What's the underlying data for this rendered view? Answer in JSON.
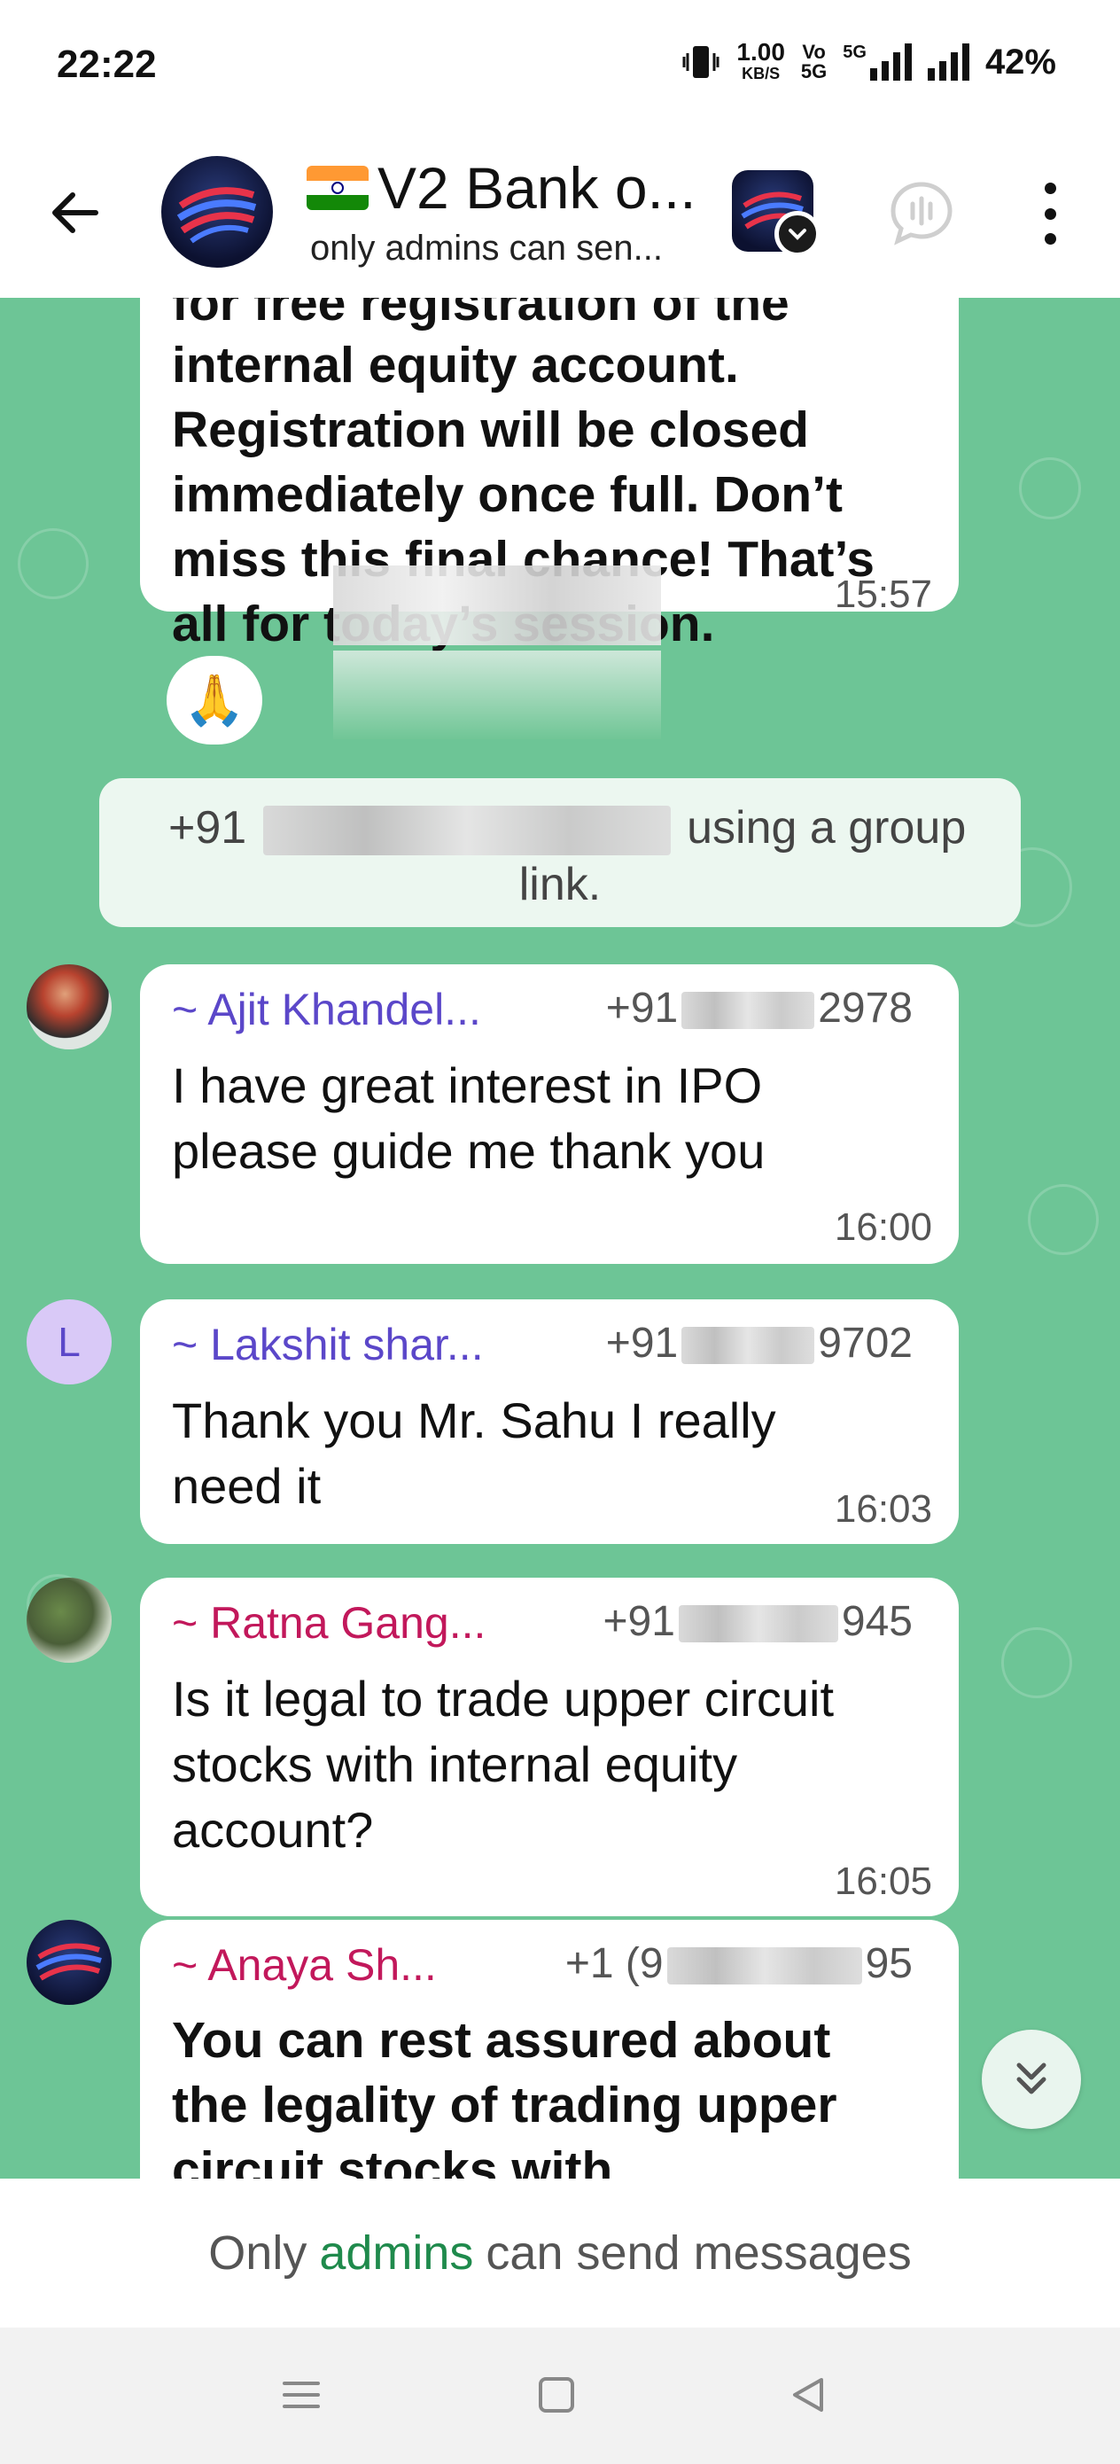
{
  "status_bar": {
    "time": "22:22",
    "net_speed_value": "1.00",
    "net_speed_unit": "KB/S",
    "volte_top": "Vo",
    "volte_bottom": "5G",
    "network_label": "5G",
    "battery": "42%"
  },
  "header": {
    "title": "V2 Bank o...",
    "subtitle": "only admins can sen...",
    "icons": [
      "back-arrow-icon",
      "group-avatar",
      "dropdown-chevron-icon",
      "voice-chat-icon",
      "more-vertical-icon"
    ]
  },
  "messages": {
    "m1": {
      "partial_line": "for free registration of the",
      "text": "internal equity account. Registration will be closed immediately once full. Don’t miss this final chance! That’s all for today’s session.",
      "time": "15:57",
      "reaction": "🙏"
    },
    "system": {
      "prefix": "+91",
      "suffix": "using a group",
      "line2": "link."
    },
    "m2": {
      "sender": "~ Ajit Khandel...",
      "phone_prefix": "+91",
      "phone_suffix": "2978",
      "text": "I have great interest in IPO please guide me thank you",
      "time": "16:00",
      "sender_color": "#5b47c9"
    },
    "m3": {
      "avatar_letter": "L",
      "sender": "~ Lakshit shar...",
      "phone_prefix": "+91",
      "phone_suffix": "9702",
      "text": "Thank you Mr. Sahu I really need it",
      "time": "16:03",
      "sender_color": "#5b47c9"
    },
    "m4": {
      "sender": "~ Ratna Gang...",
      "phone_prefix": "+91",
      "phone_suffix": "945",
      "text": "Is it legal to trade upper circuit stocks with internal equity account?",
      "time": "16:05",
      "sender_color": "#c2185b"
    },
    "m5": {
      "sender": "~ Anaya Sh...",
      "phone_prefix": "+1 (9",
      "phone_suffix": "95",
      "text": "You can rest assured about the legality of trading upper circuit stocks with",
      "sender_color": "#c2185b"
    }
  },
  "footer": {
    "prefix": "Only",
    "admins_link": "admins",
    "suffix": "can send messages"
  },
  "colors": {
    "chat_background": "#6dc596",
    "accent_green": "#1f8a4c"
  }
}
